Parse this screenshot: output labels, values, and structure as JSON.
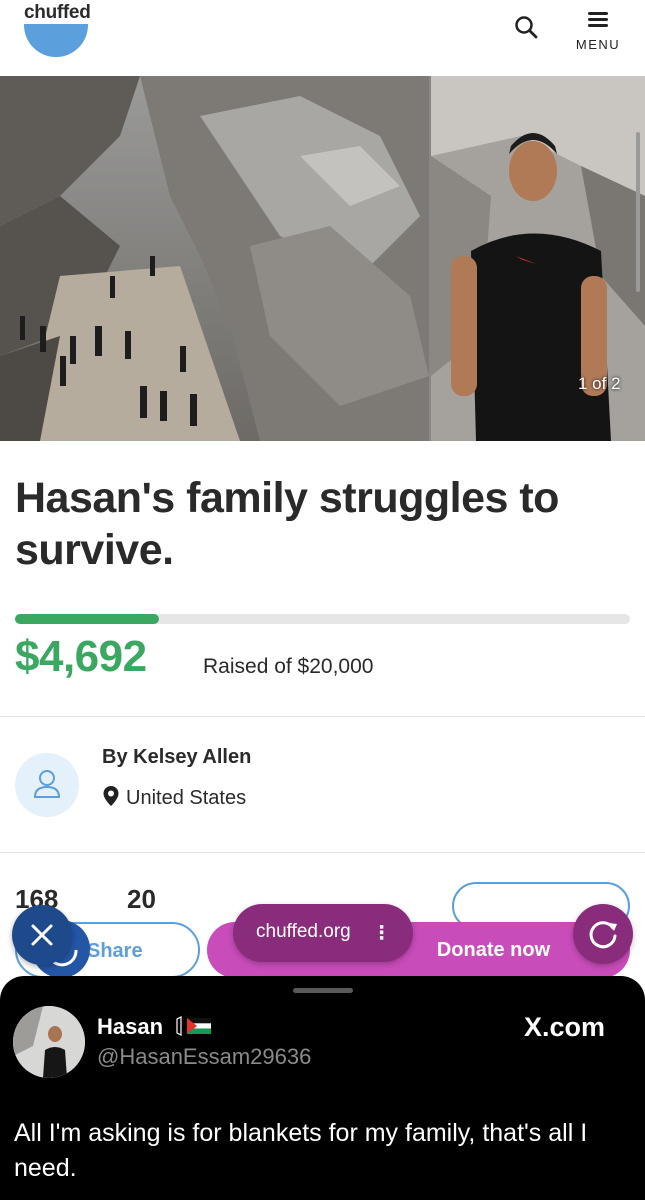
{
  "header": {
    "logo_text": "chuffed",
    "menu_label": "MENU",
    "brand_color": "#5b9fdc"
  },
  "gallery": {
    "counter": "1 of 2"
  },
  "campaign": {
    "title": "Hasan's family struggles to survive.",
    "raised_amount": "$4,692",
    "raised_of": "Raised of $20,000",
    "progress_fraction": 0.2346,
    "accent_green": "#3aa861"
  },
  "organizer": {
    "by": "By Kelsey Allen",
    "location": "United States"
  },
  "stats": {
    "left": "168",
    "right": "20"
  },
  "actions": {
    "share_top_label": "Share",
    "share_label": "Share",
    "donate_label": "Donate now"
  },
  "browser": {
    "url": "chuffed.org",
    "url_menu": "⋮"
  },
  "x_card": {
    "name": "Hasan",
    "handle": "@HasanEssam29636",
    "site": "X.com",
    "text": "All I'm asking is for blankets for my family, that's all I need."
  }
}
